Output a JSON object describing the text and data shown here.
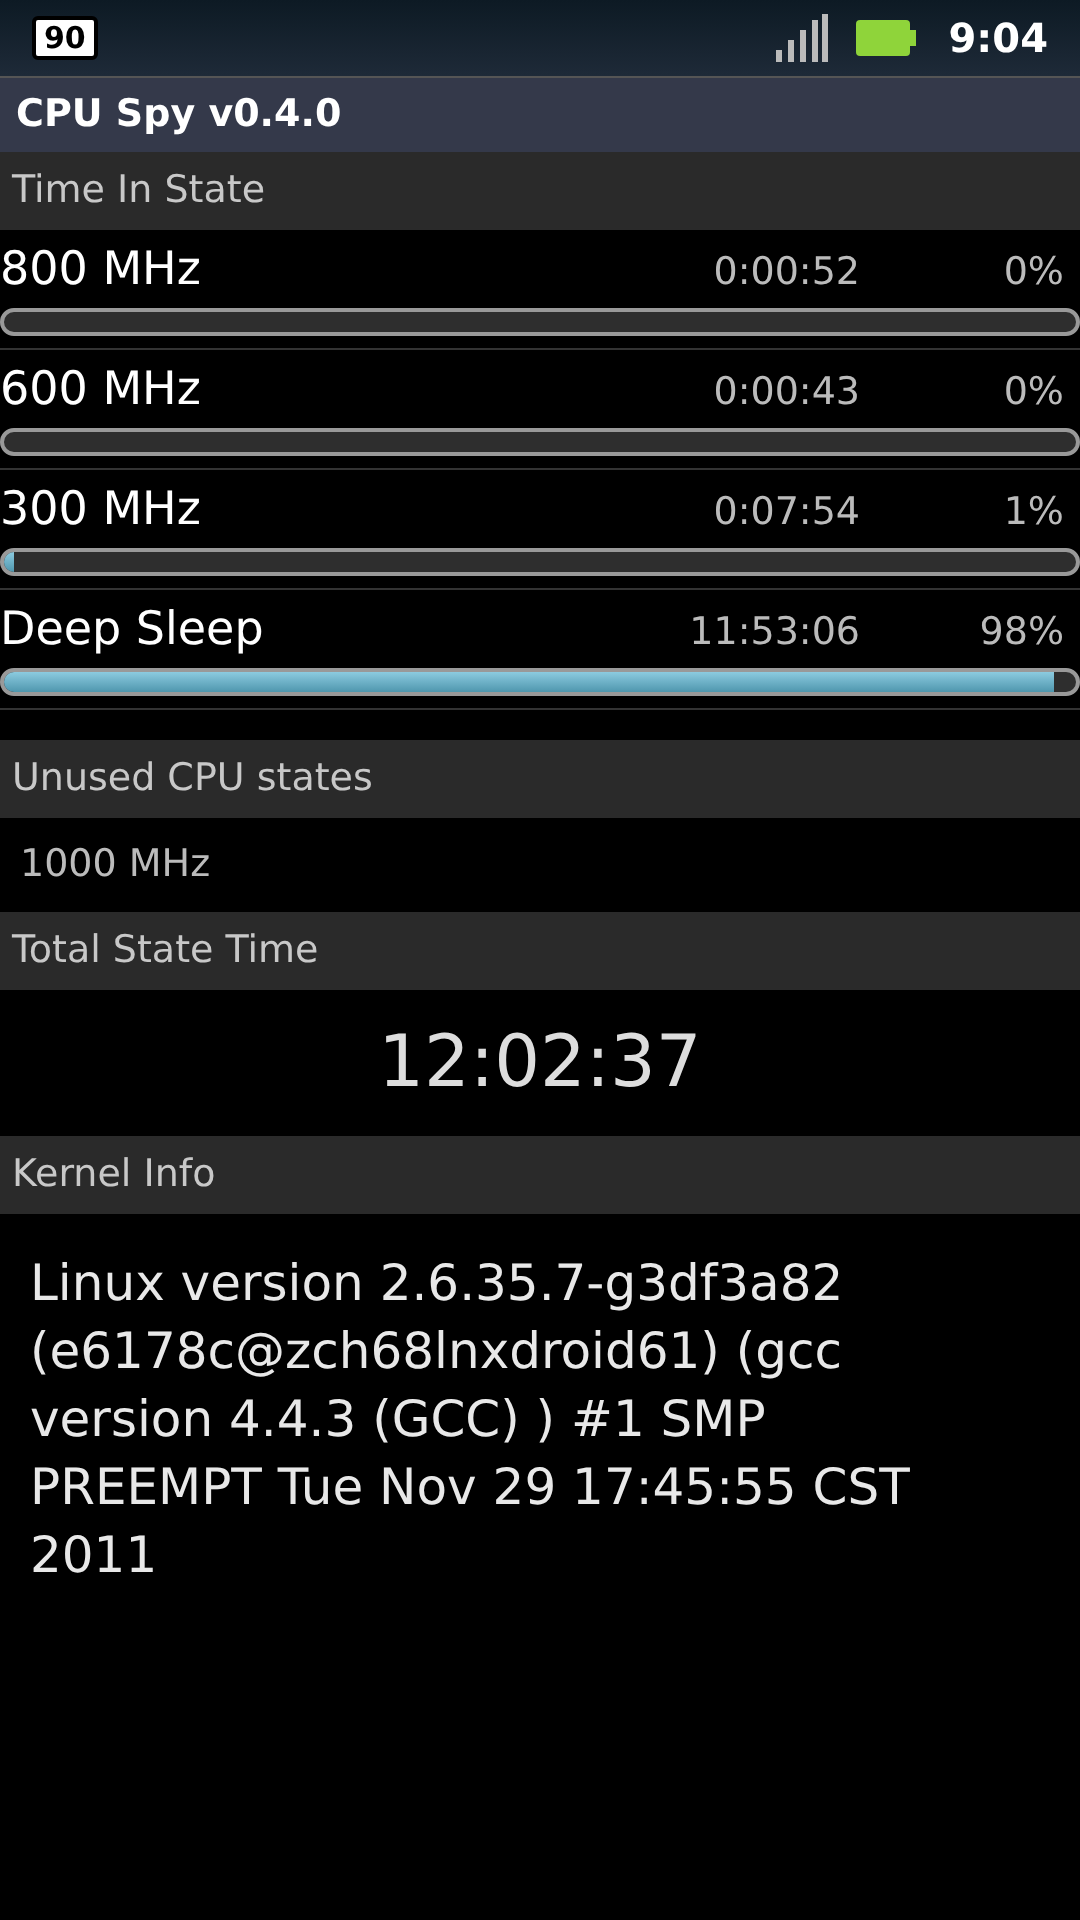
{
  "status_bar": {
    "notification_badge": "90",
    "time": "9:04"
  },
  "title_bar": {
    "title": "CPU Spy v0.4.0"
  },
  "time_in_state": {
    "header": "Time In State",
    "states": [
      {
        "name": "800 MHz",
        "time": "0:00:52",
        "percent": "0%"
      },
      {
        "name": "600 MHz",
        "time": "0:00:43",
        "percent": "0%"
      },
      {
        "name": "300 MHz",
        "time": "0:07:54",
        "percent": "1%",
        "level": 0.01
      },
      {
        "name": "Deep Sleep",
        "time": "11:53:06",
        "percent": "98%",
        "level": 0.98
      }
    ]
  },
  "unused_states": {
    "header": "Unused CPU states",
    "text": "1000 MHz"
  },
  "total_state_time": {
    "header": "Total State Time",
    "value": "12:02:37"
  },
  "kernel_info": {
    "header": "Kernel Info",
    "text": "Linux version 2.6.35.7-g3df3a82 (e6178c@zch68lnxdroid61) (gcc version 4.4.3 (GCC) ) #1 SMP PREEMPT Tue Nov 29 17:45:55 CST 2011"
  }
}
